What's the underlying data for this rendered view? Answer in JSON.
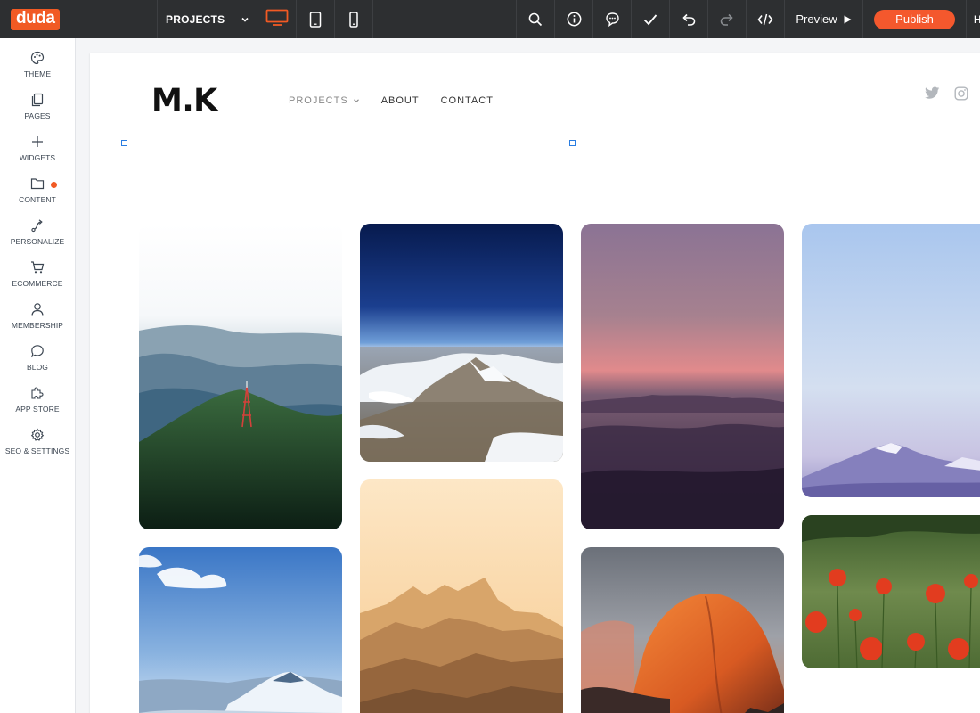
{
  "app": {
    "logo": "duda"
  },
  "toolbar": {
    "page_select": "PROJECTS",
    "preview_label": "Preview",
    "publish_label": "Publish",
    "edge_text": "H"
  },
  "sidebar": {
    "items": [
      {
        "label": "THEME",
        "icon": "palette-icon"
      },
      {
        "label": "PAGES",
        "icon": "pages-icon"
      },
      {
        "label": "WIDGETS",
        "icon": "plus-icon"
      },
      {
        "label": "CONTENT",
        "icon": "folder-icon",
        "badge": true
      },
      {
        "label": "PERSONALIZE",
        "icon": "personalize-icon"
      },
      {
        "label": "ECOMMERCE",
        "icon": "cart-icon"
      },
      {
        "label": "MEMBERSHIP",
        "icon": "user-icon"
      },
      {
        "label": "BLOG",
        "icon": "chat-bubble-icon"
      },
      {
        "label": "APP STORE",
        "icon": "puzzle-icon"
      },
      {
        "label": "SEO & SETTINGS",
        "icon": "gear-icon"
      }
    ]
  },
  "site": {
    "logo_text": "M.K",
    "nav": [
      {
        "label": "PROJECTS",
        "dropdown": true
      },
      {
        "label": "ABOUT"
      },
      {
        "label": "CONTACT"
      }
    ],
    "social": [
      "twitter-icon",
      "instagram-icon"
    ]
  },
  "colors": {
    "accent": "#f15a24",
    "topbar": "#2d2f31",
    "publish": "#f4582d"
  }
}
